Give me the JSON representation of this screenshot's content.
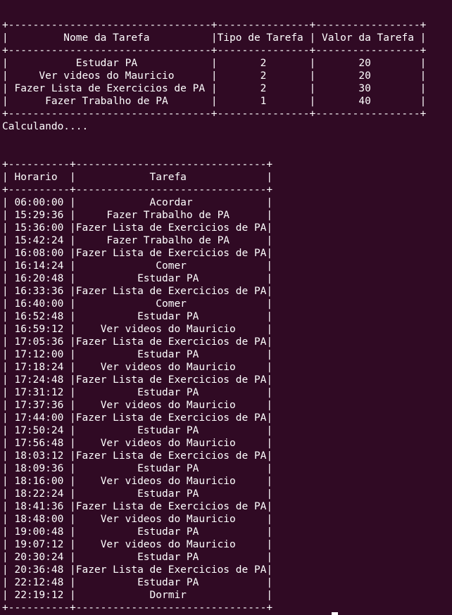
{
  "terminal": {
    "background": "#300a24",
    "foreground": "#ffffff",
    "tasks_table": {
      "headers": [
        "Nome da Tarefa",
        "Tipo de Tarefa",
        "Valor da Tarefa"
      ],
      "rows": [
        [
          "Estudar PA",
          "2",
          "20"
        ],
        [
          "Ver videos do Mauricio",
          "2",
          "20"
        ],
        [
          "Fazer Lista de Exercicios de PA",
          "2",
          "30"
        ],
        [
          "Fazer Trabalho de PA",
          "1",
          "40"
        ]
      ]
    },
    "status_message": "Calculando....",
    "schedule_table": {
      "headers": [
        "Horario",
        "Tarefa"
      ],
      "rows": [
        [
          "06:00:00",
          "Acordar"
        ],
        [
          "15:29:36",
          "Fazer Trabalho de PA"
        ],
        [
          "15:36:00",
          "Fazer Lista de Exercicios de PA"
        ],
        [
          "15:42:24",
          "Fazer Trabalho de PA"
        ],
        [
          "16:08:00",
          "Fazer Lista de Exercicios de PA"
        ],
        [
          "16:14:24",
          "Comer"
        ],
        [
          "16:20:48",
          "Estudar PA"
        ],
        [
          "16:33:36",
          "Fazer Lista de Exercicios de PA"
        ],
        [
          "16:40:00",
          "Comer"
        ],
        [
          "16:52:48",
          "Estudar PA"
        ],
        [
          "16:59:12",
          "Ver videos do Mauricio"
        ],
        [
          "17:05:36",
          "Fazer Lista de Exercicios de PA"
        ],
        [
          "17:12:00",
          "Estudar PA"
        ],
        [
          "17:18:24",
          "Ver videos do Mauricio"
        ],
        [
          "17:24:48",
          "Fazer Lista de Exercicios de PA"
        ],
        [
          "17:31:12",
          "Estudar PA"
        ],
        [
          "17:37:36",
          "Ver videos do Mauricio"
        ],
        [
          "17:44:00",
          "Fazer Lista de Exercicios de PA"
        ],
        [
          "17:50:24",
          "Estudar PA"
        ],
        [
          "17:56:48",
          "Ver videos do Mauricio"
        ],
        [
          "18:03:12",
          "Fazer Lista de Exercicios de PA"
        ],
        [
          "18:09:36",
          "Estudar PA"
        ],
        [
          "18:16:00",
          "Ver videos do Mauricio"
        ],
        [
          "18:22:24",
          "Estudar PA"
        ],
        [
          "18:41:36",
          "Fazer Lista de Exercicios de PA"
        ],
        [
          "18:48:00",
          "Ver videos do Mauricio"
        ],
        [
          "19:00:48",
          "Estudar PA"
        ],
        [
          "19:07:12",
          "Ver videos do Mauricio"
        ],
        [
          "20:30:24",
          "Estudar PA"
        ],
        [
          "20:36:48",
          "Fazer Lista de Exercicios de PA"
        ],
        [
          "22:12:48",
          "Estudar PA"
        ],
        [
          "22:19:12",
          "Dormir"
        ]
      ]
    }
  }
}
